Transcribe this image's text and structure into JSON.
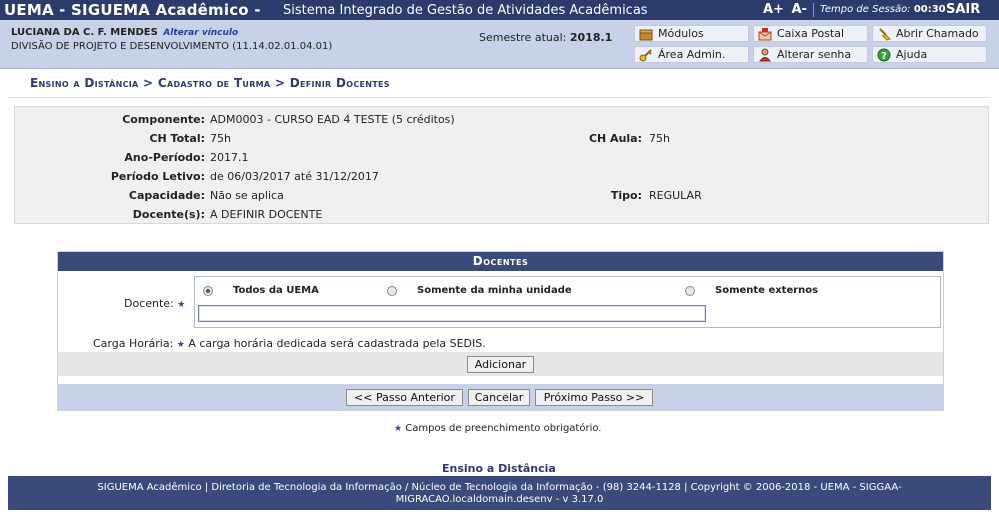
{
  "header": {
    "system_name": "UEMA - SIGUEMA Acadêmico -",
    "system_subtitle": "Sistema Integrado de Gestão de Atividades Acadêmicas",
    "font_increase": "A+",
    "font_decrease": "A-",
    "session_label": "Tempo de Sessão:",
    "session_time": "00:30",
    "logout": "SAIR"
  },
  "user": {
    "name": "LUCIANA DA C. F. MENDES",
    "change_link": "Alterar vínculo",
    "division": "DIVISÃO DE PROJETO E DESENVOLVIMENTO (11.14.02.01.04.01)",
    "semester_label": "Semestre atual:",
    "semester_value": "2018.1"
  },
  "menu": {
    "modulos": "Módulos",
    "caixa_postal": "Caixa Postal",
    "abrir_chamado": "Abrir Chamado",
    "area_admin": "Área Admin.",
    "alterar_senha": "Alterar senha",
    "ajuda": "Ajuda"
  },
  "breadcrumb": "Ensino a Distância > Cadastro de Turma > Definir Docentes",
  "details": {
    "componente_label": "Componente:",
    "componente_value": "ADM0003 - CURSO EAD 4 TESTE (5 créditos)",
    "ch_total_label": "CH Total:",
    "ch_total_value": "75h",
    "ch_aula_label": "CH Aula:",
    "ch_aula_value": "75h",
    "ano_periodo_label": "Ano-Período:",
    "ano_periodo_value": "2017.1",
    "periodo_letivo_label": "Período Letivo:",
    "periodo_letivo_value": "de 06/03/2017 até 31/12/2017",
    "capacidade_label": "Capacidade:",
    "capacidade_value": "Não se aplica",
    "tipo_label": "Tipo:",
    "tipo_value": "REGULAR",
    "docentes_label": "Docente(s):",
    "docentes_value": "A DEFINIR DOCENTE"
  },
  "form": {
    "title": "Docentes",
    "docente_label": "Docente:",
    "radio_all": "Todos da UEMA",
    "radio_unit": "Somente da minha unidade",
    "radio_external": "Somente externos",
    "docente_value": "",
    "carga_label": "Carga Horária:",
    "carga_text": "A carga horária dedicada será cadastrada pela SEDIS.",
    "add_button": "Adicionar",
    "prev_button": "<< Passo Anterior",
    "cancel_button": "Cancelar",
    "next_button": "Próximo Passo >>"
  },
  "required_note": "Campos de preenchimento obrigatório.",
  "footer": {
    "link": "Ensino a Distância",
    "line1": "SIGUEMA Acadêmico | Diretoria de Tecnologia da Informação / Núcleo de Tecnologia da Informação - (98) 3244-1128 | Copyright © 2006-2018 - UEMA - SIGGAA-",
    "line2": "MIGRACAO.localdomain.desenv - v 3.17.0"
  }
}
